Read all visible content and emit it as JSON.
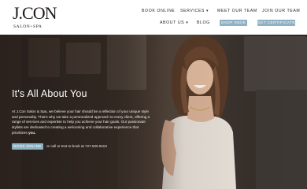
{
  "logo": {
    "main": "J.CON",
    "sub": "SALON+SPA"
  },
  "nav": {
    "book_online": "BOOK ONLINE",
    "services": "SERVICES ▾",
    "meet_team": "MEET OUR TEAM",
    "join_team": "JOIN OUR TEAM",
    "about": "ABOUT US ▾",
    "blog": "BLOG",
    "shop_button": "SHOP INDIE",
    "gift_button": "GET CERTIFICATE"
  },
  "hero": {
    "title": "It's All About You",
    "body": "At J.Con Salon & Spa, we believe your hair should be a reflection of your unique style and personality. That's why we take a personalized approach to every client, offering a range of services and expertise to help you achieve your hair goals. Our passionate stylists are dedicated to creating a welcoming and collaborative experience that prioritizes ",
    "body_emphasis": "you.",
    "book_button": "BOOK ONLINE",
    "call_text": "or call or text to book at 727.525.9119"
  },
  "colors": {
    "accent": "#8fb1c4",
    "header_bg": "#ffffff"
  }
}
